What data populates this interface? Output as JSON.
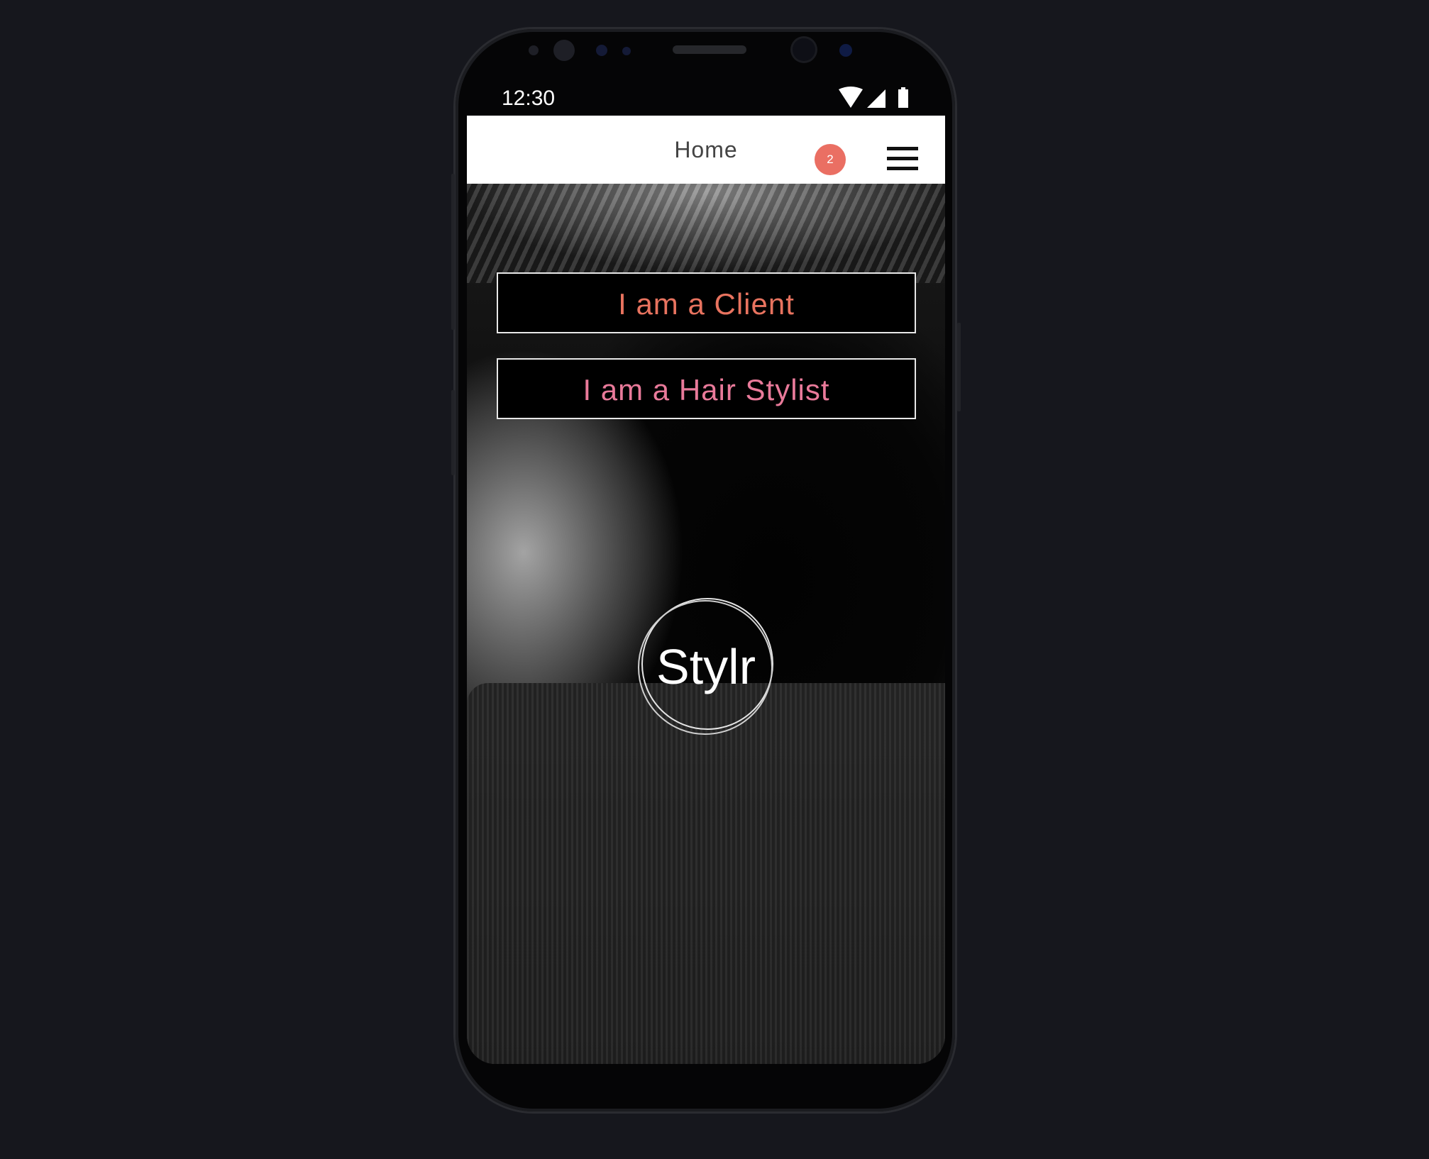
{
  "status_bar": {
    "time": "12:30",
    "icons": [
      "wifi-icon",
      "signal-icon",
      "battery-icon"
    ]
  },
  "header": {
    "title": "Home",
    "notification_count": "2",
    "menu_icon": "hamburger-menu-icon"
  },
  "main": {
    "buttons": [
      {
        "label": "I am a Client",
        "color": "#e8735f"
      },
      {
        "label": "I am a Hair Stylist",
        "color": "#e97a9a"
      }
    ],
    "logo_text": "Stylr"
  },
  "colors": {
    "badge": "#ea6f63",
    "background": "#16171d"
  }
}
